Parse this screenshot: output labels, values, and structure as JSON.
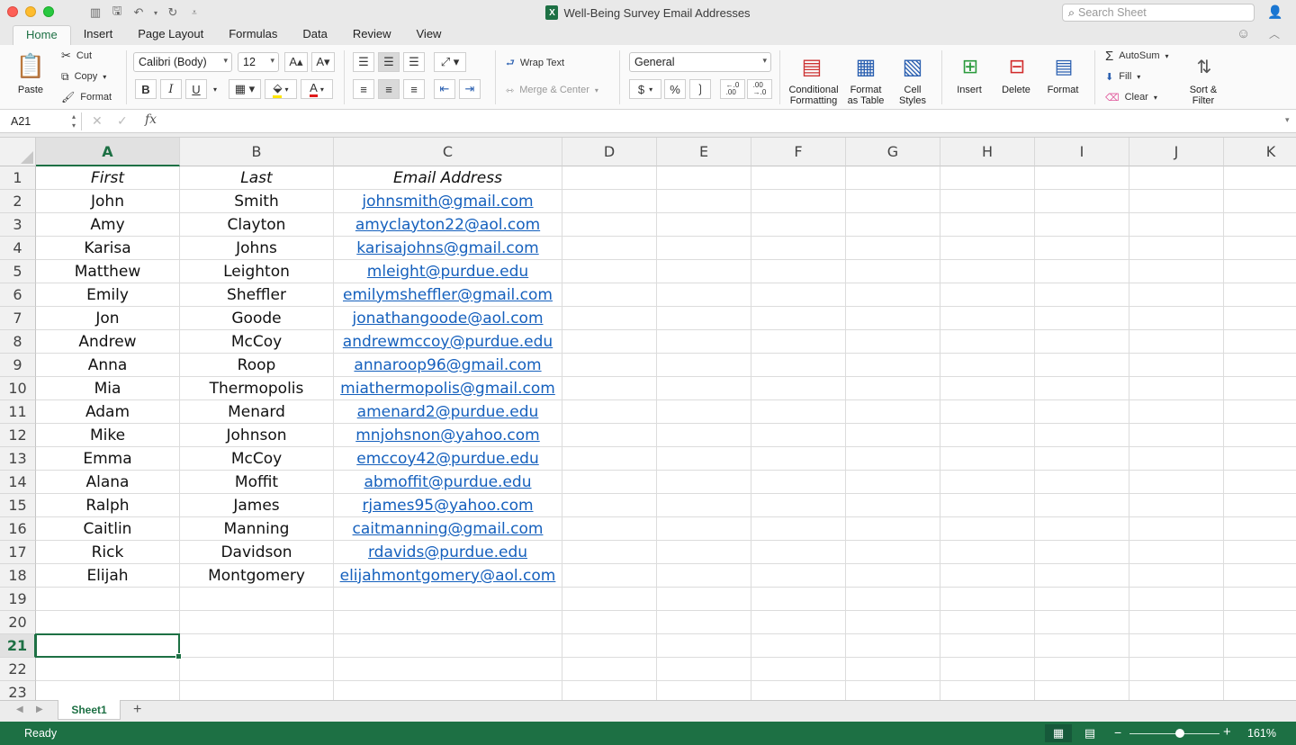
{
  "window": {
    "title": "Well-Being Survey Email Addresses",
    "search_placeholder": "Search Sheet"
  },
  "ribbon_tabs": [
    "Home",
    "Insert",
    "Page Layout",
    "Formulas",
    "Data",
    "Review",
    "View"
  ],
  "active_tab": "Home",
  "clipboard": {
    "paste": "Paste",
    "cut": "Cut",
    "copy": "Copy",
    "format": "Format"
  },
  "font": {
    "name": "Calibri (Body)",
    "size": "12",
    "bold": "B",
    "italic": "I",
    "underline": "U"
  },
  "alignment": {
    "wrap_text": "Wrap Text",
    "merge_center": "Merge & Center"
  },
  "number": {
    "format": "General",
    "currency": "$",
    "percent": "%",
    "comma": "❳",
    "inc_decimal": "←.0\n.00",
    "dec_decimal": ".00\n→.0"
  },
  "styles": {
    "conditional_1": "Conditional",
    "conditional_2": "Formatting",
    "format_table_1": "Format",
    "format_table_2": "as Table",
    "cell_styles_1": "Cell",
    "cell_styles_2": "Styles"
  },
  "cells_group": {
    "insert": "Insert",
    "delete": "Delete",
    "format": "Format"
  },
  "editing": {
    "autosum": "AutoSum",
    "fill": "Fill",
    "clear": "Clear",
    "sort_1": "Sort &",
    "sort_2": "Filter"
  },
  "formula_bar": {
    "name_box": "A21",
    "fx": "fx",
    "value": ""
  },
  "columns": [
    "A",
    "B",
    "C",
    "D",
    "E",
    "F",
    "G",
    "H",
    "I",
    "J",
    "K"
  ],
  "selected_column": "A",
  "selected_row": "21",
  "rows": [
    {
      "num": "1",
      "a": "First",
      "b": "Last",
      "c": "Email Address"
    },
    {
      "num": "2",
      "a": "John",
      "b": "Smith",
      "c": "johnsmith@gmail.com"
    },
    {
      "num": "3",
      "a": "Amy",
      "b": "Clayton",
      "c": "amyclayton22@aol.com"
    },
    {
      "num": "4",
      "a": "Karisa",
      "b": "Johns",
      "c": "karisajohns@gmail.com"
    },
    {
      "num": "5",
      "a": "Matthew",
      "b": "Leighton",
      "c": "mleight@purdue.edu"
    },
    {
      "num": "6",
      "a": "Emily",
      "b": "Sheffler",
      "c": "emilymsheffler@gmail.com"
    },
    {
      "num": "7",
      "a": "Jon",
      "b": "Goode",
      "c": "jonathangoode@aol.com"
    },
    {
      "num": "8",
      "a": "Andrew",
      "b": "McCoy",
      "c": "andrewmccoy@purdue.edu"
    },
    {
      "num": "9",
      "a": "Anna",
      "b": "Roop",
      "c": "annaroop96@gmail.com"
    },
    {
      "num": "10",
      "a": "Mia",
      "b": "Thermopolis",
      "c": "miathermopolis@gmail.com"
    },
    {
      "num": "11",
      "a": "Adam",
      "b": "Menard",
      "c": "amenard2@purdue.edu"
    },
    {
      "num": "12",
      "a": "Mike",
      "b": "Johnson",
      "c": "mnjohsnon@yahoo.com"
    },
    {
      "num": "13",
      "a": "Emma",
      "b": "McCoy",
      "c": "emccoy42@purdue.edu"
    },
    {
      "num": "14",
      "a": "Alana",
      "b": "Moffit",
      "c": "abmoffit@purdue.edu"
    },
    {
      "num": "15",
      "a": "Ralph",
      "b": "James",
      "c": "rjames95@yahoo.com"
    },
    {
      "num": "16",
      "a": "Caitlin",
      "b": "Manning",
      "c": "caitmanning@gmail.com"
    },
    {
      "num": "17",
      "a": "Rick",
      "b": "Davidson",
      "c": "rdavids@purdue.edu"
    },
    {
      "num": "18",
      "a": "Elijah",
      "b": "Montgomery",
      "c": "elijahmontgomery@aol.com"
    },
    {
      "num": "19",
      "a": "",
      "b": "",
      "c": ""
    },
    {
      "num": "20",
      "a": "",
      "b": "",
      "c": ""
    },
    {
      "num": "21",
      "a": "",
      "b": "",
      "c": ""
    },
    {
      "num": "22",
      "a": "",
      "b": "",
      "c": ""
    },
    {
      "num": "23",
      "a": "",
      "b": "",
      "c": ""
    }
  ],
  "sheets": [
    "Sheet1"
  ],
  "status": {
    "ready": "Ready",
    "zoom": "161%"
  },
  "colors": {
    "accent": "#1d7044",
    "link": "#1560bd"
  }
}
